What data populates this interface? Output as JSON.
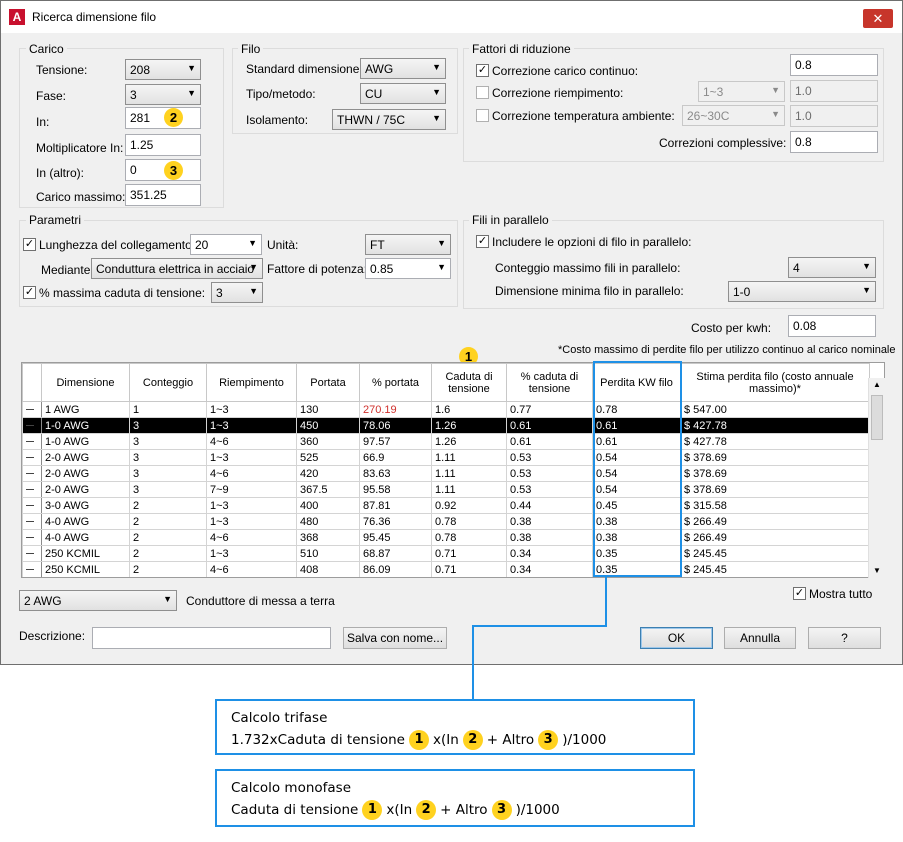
{
  "window": {
    "title": "Ricerca dimensione filo",
    "close": "✕"
  },
  "carico": {
    "group": "Carico",
    "tensione_label": "Tensione:",
    "tensione": "208",
    "fase_label": "Fase:",
    "fase": "3",
    "in_label": "In:",
    "in": "281",
    "molt_label": "Moltiplicatore In:",
    "molt": "1.25",
    "in_altro_label": "In (altro):",
    "in_altro": "0",
    "carico_label": "Carico massimo:",
    "carico": "351.25"
  },
  "filo": {
    "group": "Filo",
    "standard_label": "Standard dimensione:",
    "standard": "AWG",
    "tipo_label": "Tipo/metodo:",
    "tipo": "CU",
    "isolamento_label": "Isolamento:",
    "isolamento": "THWN / 75C"
  },
  "fattori": {
    "group": "Fattori di riduzione",
    "continuo_label": "Correzione carico continuo:",
    "continuo_value": "0.8",
    "riempimento_label": "Correzione riempimento:",
    "riempimento_combo": "1~3",
    "riempimento_value": "1.0",
    "temperatura_label": "Correzione temperatura ambiente:",
    "temperatura_combo": "26~30C",
    "temperatura_value": "1.0",
    "complessive_label": "Correzioni complessive:",
    "complessive_value": "0.8"
  },
  "parametri": {
    "group": "Parametri",
    "lunghezza_label": "Lunghezza del collegamento:",
    "lunghezza": "20",
    "unita_label": "Unità:",
    "unita": "FT",
    "mediante_label": "Mediante:",
    "mediante": "Conduttura elettrica in acciaio",
    "fattore_label": "Fattore di potenza:",
    "fattore": "0.85",
    "caduta_label": "% massima caduta di tensione:",
    "caduta": "3"
  },
  "parallelo": {
    "group": "Fili in parallelo",
    "includere_label": "Includere le opzioni di filo in parallelo:",
    "conteggio_label": "Conteggio massimo fili in parallelo:",
    "conteggio": "4",
    "dimensione_label": "Dimensione minima filo in parallelo:",
    "dimensione": "1-0"
  },
  "costo": {
    "label": "Costo per kwh:",
    "value": "0.08",
    "note": "*Costo massimo di perdite filo per utilizzo continuo al carico nominale"
  },
  "grid": {
    "headers": [
      "Dimensione",
      "Conteggio",
      "Riempimento",
      "Portata",
      "% portata",
      "Caduta di tensione",
      "% caduta di tensione",
      "Perdita KW filo",
      "Stima perdita filo (costo annuale massimo)*"
    ],
    "rows": [
      [
        "1 AWG",
        "1",
        "1~3",
        "130",
        "270.19",
        "1.6",
        "0.77",
        "0.78",
        "$ 547.00"
      ],
      [
        "1-0 AWG",
        "3",
        "1~3",
        "450",
        "78.06",
        "1.26",
        "0.61",
        "0.61",
        "$ 427.78"
      ],
      [
        "1-0 AWG",
        "3",
        "4~6",
        "360",
        "97.57",
        "1.26",
        "0.61",
        "0.61",
        "$ 427.78"
      ],
      [
        "2-0 AWG",
        "3",
        "1~3",
        "525",
        "66.9",
        "1.11",
        "0.53",
        "0.54",
        "$ 378.69"
      ],
      [
        "2-0 AWG",
        "3",
        "4~6",
        "420",
        "83.63",
        "1.11",
        "0.53",
        "0.54",
        "$ 378.69"
      ],
      [
        "2-0 AWG",
        "3",
        "7~9",
        "367.5",
        "95.58",
        "1.11",
        "0.53",
        "0.54",
        "$ 378.69"
      ],
      [
        "3-0 AWG",
        "2",
        "1~3",
        "400",
        "87.81",
        "0.92",
        "0.44",
        "0.45",
        "$ 315.58"
      ],
      [
        "4-0 AWG",
        "2",
        "1~3",
        "480",
        "76.36",
        "0.78",
        "0.38",
        "0.38",
        "$ 266.49"
      ],
      [
        "4-0 AWG",
        "2",
        "4~6",
        "368",
        "95.45",
        "0.78",
        "0.38",
        "0.38",
        "$ 266.49"
      ],
      [
        "250 KCMIL",
        "2",
        "1~3",
        "510",
        "68.87",
        "0.71",
        "0.34",
        "0.35",
        "$ 245.45"
      ],
      [
        "250 KCMIL",
        "2",
        "4~6",
        "408",
        "86.09",
        "0.71",
        "0.34",
        "0.35",
        "$ 245.45"
      ]
    ],
    "selected_row": 1,
    "overload_color": "#d0312d"
  },
  "bottom": {
    "terra_combo": "2 AWG",
    "terra_label": "Conduttore di messa a terra",
    "mostra_label": "Mostra tutto",
    "descrizione_label": "Descrizione:",
    "descrizione_value": "",
    "salva": "Salva con nome...",
    "ok": "OK",
    "annulla": "Annulla",
    "help": "?"
  },
  "badges": {
    "one": "1",
    "two": "2",
    "three": "3"
  },
  "callouts": {
    "trifase_title": "Calcolo trifase",
    "trifase_a": "1.732xCaduta di tensione",
    "trifase_b": "x(In",
    "trifase_c": "+ Altro",
    "trifase_d": ")/1000",
    "monofase_title": "Calcolo monofase",
    "monofase_a": "Caduta di tensione",
    "monofase_b": "x(In",
    "monofase_c": "+ Altro",
    "monofase_d": ")/1000"
  },
  "colors": {
    "highlight": "#1e90e6",
    "badge": "#ffd21f"
  }
}
